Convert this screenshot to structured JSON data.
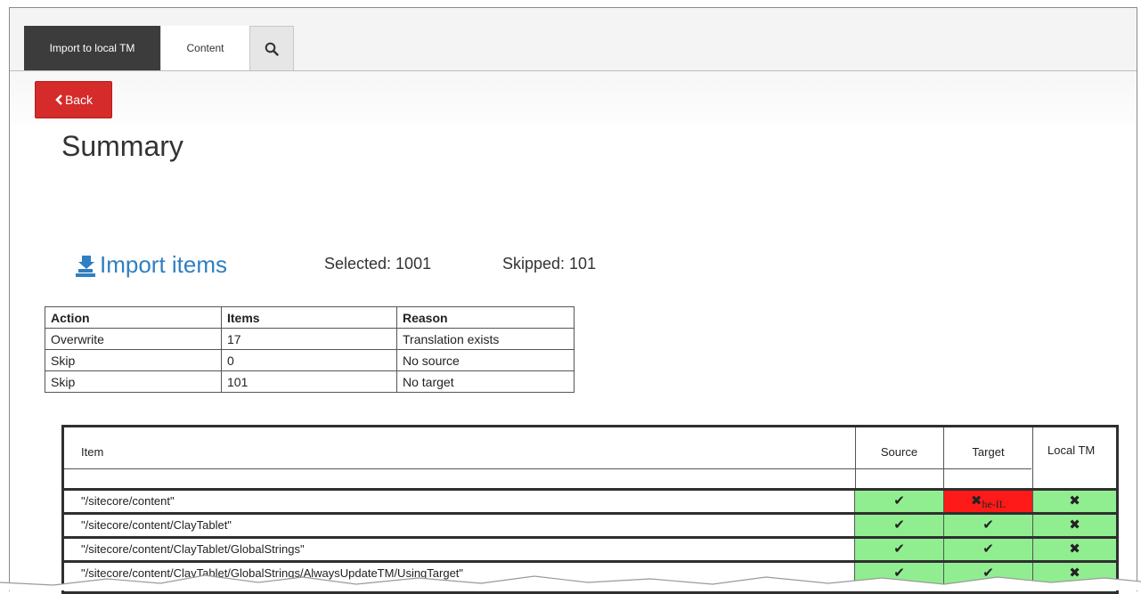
{
  "tabs": [
    {
      "label": "Import to local TM"
    },
    {
      "label": "Content"
    }
  ],
  "icons": {
    "search": "search-icon",
    "back": "chevron-left-icon",
    "import": "import-icon",
    "check": "check-icon",
    "cross": "cross-icon"
  },
  "toolbar": {
    "back_label": "Back"
  },
  "page": {
    "title": "Summary",
    "import_label": "Import items",
    "selected": "Selected: 1001",
    "skipped": "Skipped: 101"
  },
  "summary_table": {
    "headers": [
      "Action",
      "Items",
      "Reason"
    ],
    "rows": [
      [
        "Overwrite",
        "17",
        "Translation exists"
      ],
      [
        "Skip",
        "0",
        "No source"
      ],
      [
        "Skip",
        "101",
        "No target"
      ]
    ]
  },
  "items_table": {
    "headers": {
      "item": "Item",
      "source": "Source",
      "target": "Target",
      "local_tm": "Local TM"
    },
    "rows": [
      {
        "path": "\"/sitecore/content\"",
        "source": "✔",
        "target": "✖",
        "target_lang": "he-IL",
        "target_error": true,
        "local_tm": "✖"
      },
      {
        "path": "\"/sitecore/content/ClayTablet\"",
        "source": "✔",
        "target": "✔",
        "local_tm": "✖"
      },
      {
        "path": "\"/sitecore/content/ClayTablet/GlobalStrings\"",
        "source": "✔",
        "target": "✔",
        "local_tm": "✖"
      },
      {
        "path": "\"/sitecore/content/ClayTablet/GlobalStrings/AlwaysUpdateTM/UsingTarget\"",
        "source": "✔",
        "target": "✔",
        "local_tm": "✖"
      }
    ]
  },
  "colors": {
    "accent": "#2f7fc1",
    "danger": "#d52b2b",
    "ok_cell": "#90ee90",
    "error_cell": "#ff1a1a",
    "dark_tab": "#3c3c3c"
  }
}
